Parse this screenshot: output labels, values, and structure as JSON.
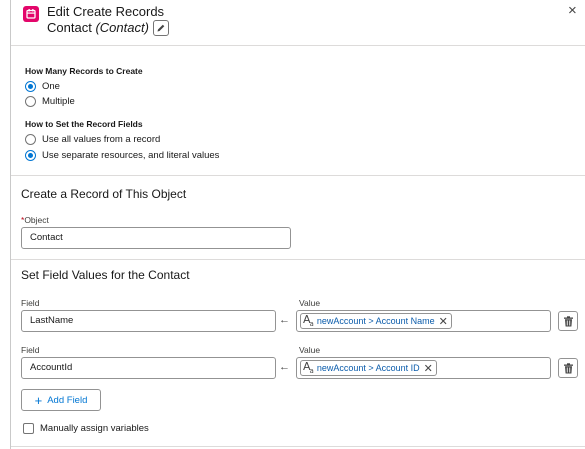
{
  "header": {
    "title": "Edit Create Records",
    "subtitle_name": "Contact",
    "subtitle_type": "(Contact)",
    "close_glyph": "×",
    "icon": "create-records-icon",
    "icon_color": "#e3066a"
  },
  "how_many": {
    "label": "How Many Records to Create",
    "options": [
      {
        "label": "One",
        "selected": true
      },
      {
        "label": "Multiple",
        "selected": false
      }
    ]
  },
  "how_set": {
    "label": "How to Set the Record Fields",
    "options": [
      {
        "label": "Use all values from a record",
        "selected": false
      },
      {
        "label": "Use separate resources, and literal values",
        "selected": true
      }
    ]
  },
  "object_section": {
    "title": "Create a Record of This Object",
    "required_mark": "*",
    "field_label": "Object",
    "field_value": "Contact"
  },
  "field_values": {
    "title": "Set Field Values for the Contact",
    "field_col_label": "Field",
    "value_col_label": "Value",
    "arrow_glyph": "←",
    "rows": [
      {
        "field": "LastName",
        "value": "newAccount > Account Name"
      },
      {
        "field": "AccountId",
        "value": "newAccount > Account ID"
      }
    ],
    "add_button_label": "Add Field",
    "add_glyph": "+",
    "manual_assign_label": "Manually assign variables",
    "manual_assign_checked": false
  },
  "colors": {
    "accent": "#0176d3",
    "pill_text": "#0b5cab",
    "border": "#939393"
  }
}
